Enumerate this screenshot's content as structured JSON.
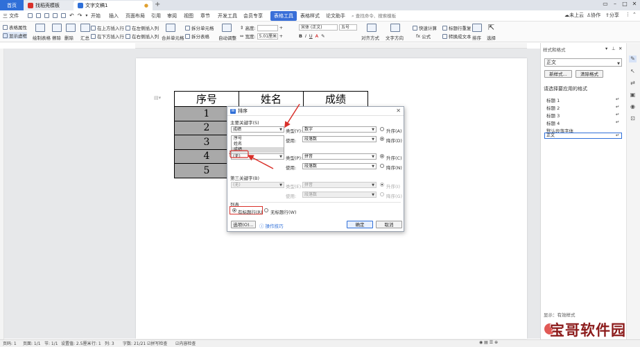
{
  "titlebar": {
    "tabs": [
      {
        "label": "首页"
      },
      {
        "label": "找稻壳模板"
      },
      {
        "label": "文字文稿1"
      }
    ],
    "add_tab": "+"
  },
  "menubar": {
    "file": "三 文件",
    "items": [
      "开始",
      "插入",
      "页面布局",
      "引用",
      "审阅",
      "视图",
      "章节",
      "开发工具",
      "会员专享",
      "表格工具",
      "表格样式",
      "论文助手"
    ],
    "active_item": "表格工具",
    "search_placeholder": "查找命令、搜索模板",
    "right": {
      "cloud": "未上云",
      "collab": "协作",
      "share": "分享"
    }
  },
  "ribbon": {
    "table_props": "表格属性",
    "show_grid": "显示虚框",
    "draw_table": "绘制表格",
    "erase": "擦除",
    "delete": "删除",
    "summary": "汇总",
    "insert_above": "在上方插入行",
    "insert_below": "在下方插入行",
    "insert_left": "在左侧插入列",
    "insert_right": "在右侧插入列",
    "merge_cells": "合并单元格",
    "split_cells": "拆分单元格",
    "split_table": "拆分表格",
    "auto_fit": "自动调整",
    "height_label": "高度:",
    "width_label": "宽度:",
    "width_value": "5.01厘米",
    "font_name": "宋体 (正文)",
    "font_size": "五号",
    "align": "对齐方式",
    "text_direction": "文字方向",
    "quick_calc": "快速计算",
    "repeat_header": "标题行重复",
    "formula": "公式",
    "convert_text": "转换成文本",
    "sort": "排序",
    "select": "选择"
  },
  "document": {
    "table": [
      [
        "序号",
        "姓名",
        "成绩"
      ],
      [
        "1",
        "",
        ""
      ],
      [
        "2",
        "",
        ""
      ],
      [
        "3",
        "",
        ""
      ],
      [
        "4",
        "",
        ""
      ],
      [
        "5",
        "",
        ""
      ]
    ]
  },
  "dialog": {
    "title": "排序",
    "primary_key_label": "主要关键字(S)",
    "primary_key_value": "成绩",
    "type_label": "类型(Y):",
    "type_value": "数字",
    "use_label": "使用:",
    "use_value": "段落数",
    "asc": "升序(A)",
    "desc": "降序(D)",
    "dropdown_options": [
      "序号",
      "姓名",
      "成绩"
    ],
    "dropdown_highlight": "成绩",
    "secondary_prefix": "次",
    "secondary_value": "(无)",
    "type2_label": "类型(P):",
    "type2_value": "拼音",
    "use2_value": "段落数",
    "asc2": "升序(C)",
    "desc2": "降序(N)",
    "third_key_label": "第三关键字(B)",
    "third_value": "(无)",
    "type3_label": "类型(E):",
    "type3_value": "拼音",
    "use3_value": "段落数",
    "asc3": "升序(I)",
    "desc3": "降序(G)",
    "list_label": "列表",
    "has_header": "有标题行(R)",
    "no_header": "无标题行(W)",
    "options_button": "选项(O)...",
    "tips_link": "操作技巧",
    "ok_button": "确定",
    "cancel_button": "取消"
  },
  "right_panel": {
    "title": "样式和格式",
    "current_style": "正文",
    "new_style": "新样式...",
    "clear_format": "清除格式",
    "apply_label": "请选择要应用的格式",
    "styles": [
      "标题 1",
      "标题 2",
      "标题 3",
      "标题 4",
      "默认段落字体",
      "正文"
    ],
    "show_label": "显示：有效样式"
  },
  "statusbar": {
    "page": "页码: 1",
    "pages": "页面: 1/1",
    "section": "节: 1/1",
    "setting": "设置值: 2.5厘米",
    "row": "行: 1",
    "col": "列: 3",
    "words": "字数: 21/21",
    "spell": "拼写检查",
    "content_check": "内容检查"
  },
  "watermark": {
    "text": "宝哥软件园"
  }
}
